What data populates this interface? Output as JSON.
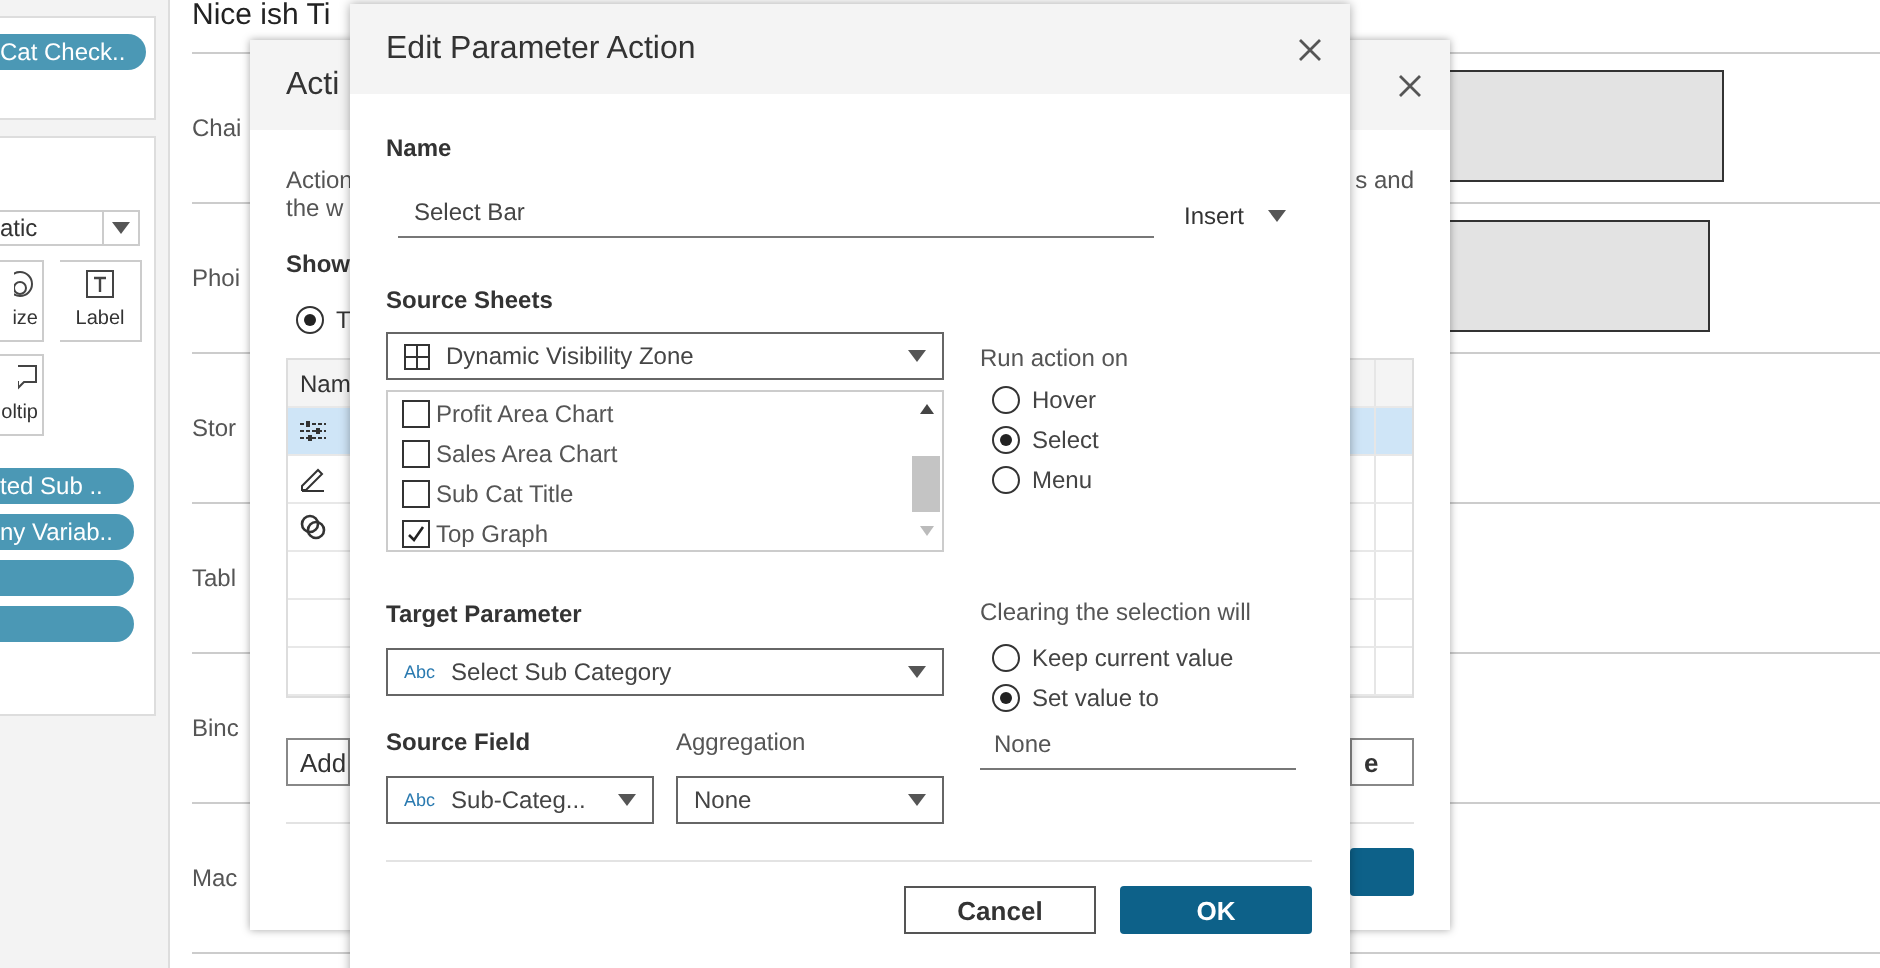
{
  "sidebar": {
    "top_pill": "Cat Check..",
    "mark_type": "atic",
    "mark_buttons": [
      {
        "kind": "size",
        "label": "ize"
      },
      {
        "kind": "label",
        "label": "Label"
      },
      {
        "kind": "tooltip",
        "label": "oltip"
      }
    ],
    "pills": [
      {
        "kind": "field",
        "label": "ted Sub .."
      },
      {
        "kind": "field",
        "label": "ny Variab.."
      },
      {
        "kind": "blank"
      },
      {
        "kind": "blank"
      }
    ]
  },
  "dashboard": {
    "title": "Nice ish Ti",
    "rows": [
      {
        "label": "Chai",
        "box": true
      },
      {
        "label": "Phoi",
        "box": true
      },
      {
        "label": "Stor",
        "box": false
      },
      {
        "label": "Tabl",
        "box": false
      },
      {
        "label": "Binc",
        "box": false
      },
      {
        "label": "Mac",
        "box": false
      }
    ]
  },
  "actions_dialog": {
    "title": "Acti",
    "intro_left": [
      "Action",
      "the w"
    ],
    "intro_right": "s and",
    "show_label": "Show",
    "show_option": {
      "label": "T",
      "selected": true
    },
    "table": {
      "header": "Nam",
      "rows": [
        {
          "kind": "sliders",
          "selected": true
        },
        {
          "kind": "pencil",
          "selected": false
        },
        {
          "kind": "rings",
          "selected": false
        }
      ]
    },
    "add_button": "Add",
    "right_button": "e"
  },
  "edit_dialog": {
    "title": "Edit Parameter Action",
    "name_label": "Name",
    "name_value": "Select Bar",
    "insert": "Insert",
    "source_sheets_label": "Source Sheets",
    "source_dashboard": "Dynamic Visibility Zone",
    "sheets": [
      {
        "label": "Profit Area Chart",
        "checked": false
      },
      {
        "label": "Sales Area Chart",
        "checked": false
      },
      {
        "label": "Sub Cat Title",
        "checked": false
      },
      {
        "label": "Top Graph",
        "checked": true
      }
    ],
    "run_label": "Run action on",
    "run_options": [
      {
        "label": "Hover",
        "selected": false
      },
      {
        "label": "Select",
        "selected": true
      },
      {
        "label": "Menu",
        "selected": false
      }
    ],
    "target_label": "Target Parameter",
    "type_badge": "Abc",
    "target_value": "Select Sub Category",
    "clearing_label": "Clearing the selection will",
    "clearing_options": [
      {
        "label": "Keep current value",
        "selected": false
      },
      {
        "label": "Set value to",
        "selected": true
      }
    ],
    "clear_value": "None",
    "source_field_label": "Source Field",
    "source_field_badge": "Abc",
    "source_field_value": "Sub-Categ...",
    "aggregation_label": "Aggregation",
    "aggregation_value": "None",
    "cancel": "Cancel",
    "ok": "OK"
  }
}
